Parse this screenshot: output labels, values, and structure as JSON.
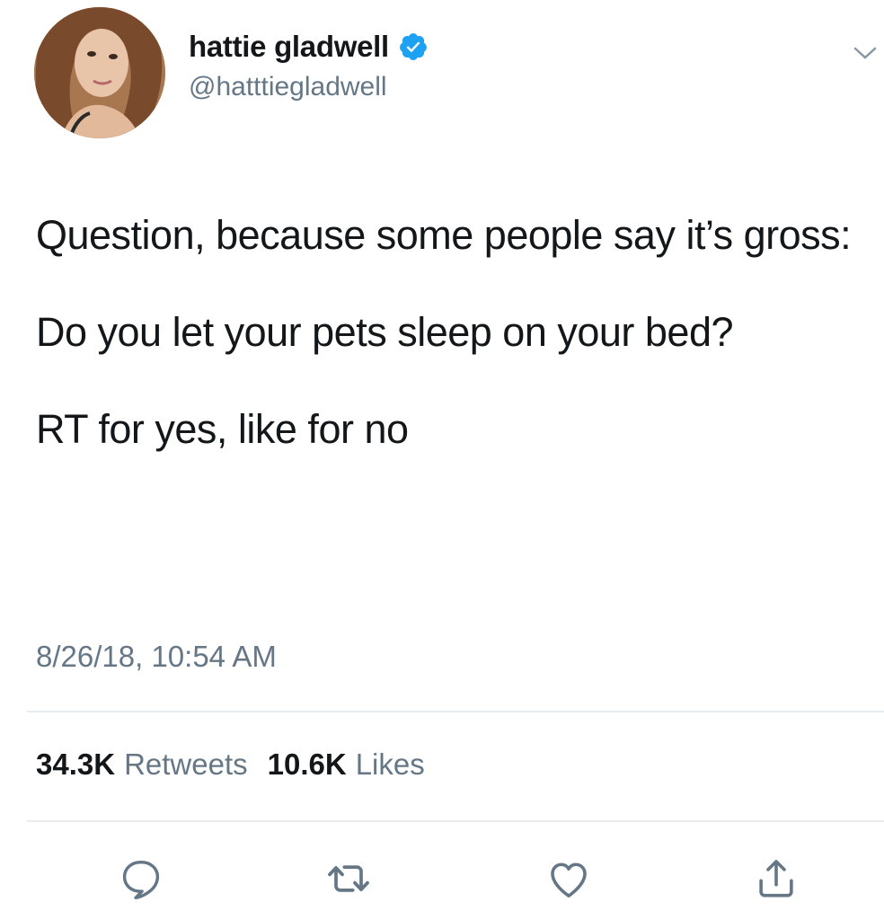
{
  "user": {
    "display_name": "hattie gladwell",
    "handle": "@hatttiegladwell",
    "verified": true,
    "avatar_icon": "user-avatar-photo"
  },
  "tweet": {
    "paragraphs": [
      "Question, because some people say it’s gross:",
      "Do you let your pets sleep on your bed?",
      "RT for yes, like for no"
    ],
    "timestamp": "8/26/18, 10:54 AM"
  },
  "stats": {
    "retweets_count": "34.3K",
    "retweets_label": "Retweets",
    "likes_count": "10.6K",
    "likes_label": "Likes"
  },
  "actions": [
    {
      "icon": "reply-icon"
    },
    {
      "icon": "retweet-icon"
    },
    {
      "icon": "like-icon"
    },
    {
      "icon": "share-icon"
    }
  ],
  "colors": {
    "text": "#14171a",
    "secondary": "#657786",
    "verified_blue": "#1da1f2",
    "divider": "#e6ecf0"
  }
}
